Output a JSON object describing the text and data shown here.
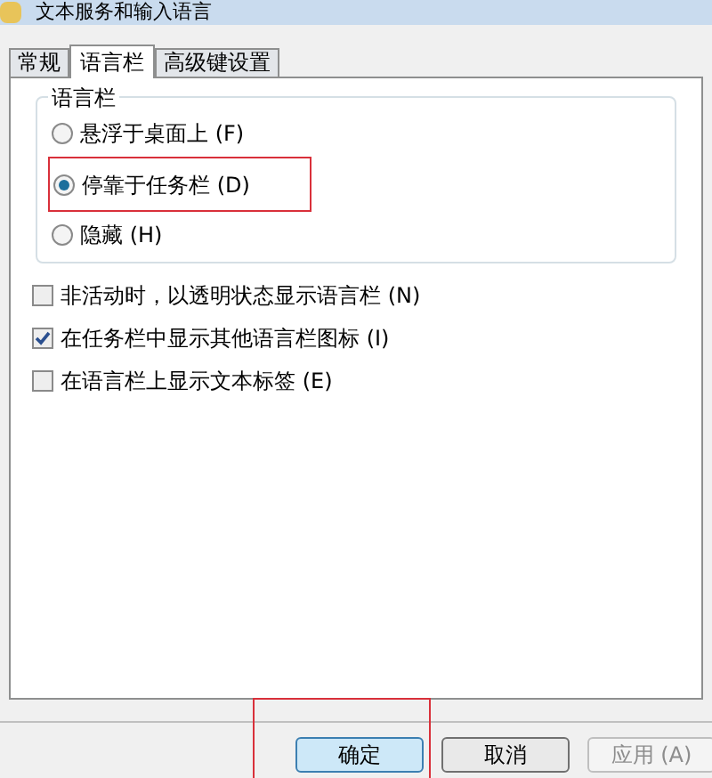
{
  "window": {
    "title": "文本服务和输入语言"
  },
  "tabs": [
    {
      "label": "常规",
      "selected": false
    },
    {
      "label": "语言栏",
      "selected": true
    },
    {
      "label": "高级键设置",
      "selected": false
    }
  ],
  "group": {
    "title": "语言栏",
    "options": [
      {
        "label": "悬浮于桌面上 (F)",
        "selected": false,
        "highlighted": false
      },
      {
        "label": "停靠于任务栏 (D)",
        "selected": true,
        "highlighted": true
      },
      {
        "label": "隐藏 (H)",
        "selected": false,
        "highlighted": false
      }
    ]
  },
  "checkboxes": [
    {
      "label": "非活动时，以透明状态显示语言栏 (N)",
      "checked": false
    },
    {
      "label": "在任务栏中显示其他语言栏图标 (I)",
      "checked": true
    },
    {
      "label": "在语言栏上显示文本标签 (E)",
      "checked": false
    }
  ],
  "buttons": [
    {
      "label": "确定",
      "default": true,
      "disabled": false,
      "highlighted": true
    },
    {
      "label": "取消",
      "default": false,
      "disabled": false,
      "highlighted": false
    },
    {
      "label": "应用 (A)",
      "default": false,
      "disabled": true,
      "highlighted": false
    }
  ]
}
